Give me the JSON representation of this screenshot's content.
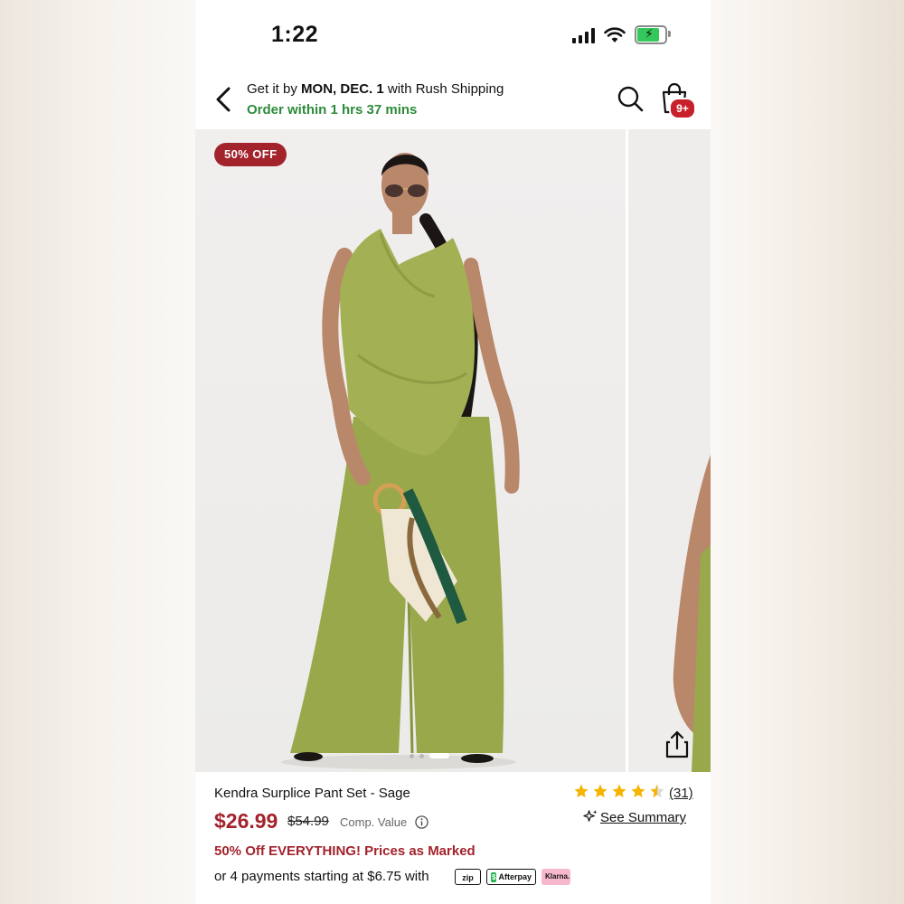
{
  "status_bar": {
    "time": "1:22"
  },
  "header": {
    "shipping_prefix": "Get it by ",
    "shipping_date": "MON, DEC. 1",
    "shipping_suffix": " with Rush Shipping",
    "order_within": "Order within 1 hrs 37 mins",
    "cart_badge": "9+"
  },
  "gallery": {
    "sale_badge": "50% OFF",
    "image_count": 3,
    "active_index": 2
  },
  "product": {
    "title": "Kendra Surplice Pant Set - Sage",
    "rating": 4.5,
    "review_count": "(31)",
    "price": "$26.99",
    "comp_price": "$54.99",
    "comp_label": "Comp. Value",
    "see_summary": "See Summary",
    "promo": "50% Off EVERYTHING! Prices as Marked",
    "payments_text": "or 4 payments starting at $6.75 with",
    "pay_badges": {
      "zip": "zip",
      "afterpay": "Afterpay",
      "klarna": "Klarna."
    }
  },
  "colors": {
    "accent_red": "#a3232c",
    "green_text": "#2e8b3a",
    "star": "#f5b400",
    "outfit": "#9aa84c"
  }
}
